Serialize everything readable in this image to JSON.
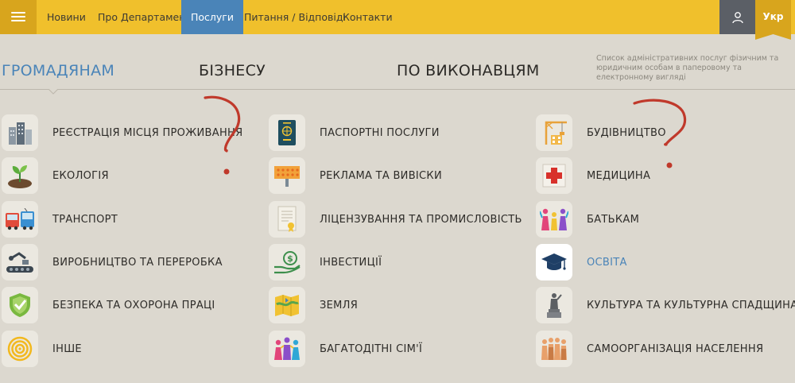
{
  "header": {
    "nav": [
      {
        "label": "Новини"
      },
      {
        "label": "Про Департамент"
      },
      {
        "label": "Послуги"
      },
      {
        "label": "Питання / Відповіді"
      },
      {
        "label": "Контакти"
      }
    ],
    "lang": "Укр"
  },
  "tabs": [
    {
      "label": "ГРОМАДЯНАМ"
    },
    {
      "label": "БІЗНЕСУ"
    },
    {
      "label": "ПО ВИКОНАВЦЯМ"
    }
  ],
  "tabs_description": "Список адміністративних послуг фізичним та юридичним особам в паперовому та електронному вигляді",
  "columns": [
    {
      "items": [
        {
          "label": "РЕЄСТРАЦІЯ МІСЦЯ ПРОЖИВАННЯ",
          "icon": "buildings-icon"
        },
        {
          "label": "ЕКОЛОГІЯ",
          "icon": "sprout-icon"
        },
        {
          "label": "ТРАНСПОРТ",
          "icon": "bus-icon"
        },
        {
          "label": "ВИРОБНИЦТВО ТА ПЕРЕРОБКА",
          "icon": "conveyor-icon"
        },
        {
          "label": "БЕЗПЕКА ТА ОХОРОНА ПРАЦІ",
          "icon": "shield-check-icon"
        },
        {
          "label": "ІНШЕ",
          "icon": "target-icon"
        }
      ]
    },
    {
      "items": [
        {
          "label": "ПАСПОРТНІ ПОСЛУГИ",
          "icon": "passport-icon"
        },
        {
          "label": "РЕКЛАМА ТА ВИВІСКИ",
          "icon": "billboard-icon"
        },
        {
          "label": "ЛІЦЕНЗУВАННЯ ТА ПРОМИСЛОВІСТЬ",
          "icon": "certificate-icon"
        },
        {
          "label": "ІНВЕСТИЦІЇ",
          "icon": "money-hand-icon"
        },
        {
          "label": "ЗЕМЛЯ",
          "icon": "map-icon"
        },
        {
          "label": "БАГАТОДІТНІ СІМ'Ї",
          "icon": "family-icon"
        }
      ]
    },
    {
      "items": [
        {
          "label": "БУДІВНИЦТВО",
          "icon": "crane-icon"
        },
        {
          "label": "МЕДИЦИНА",
          "icon": "medical-cross-icon"
        },
        {
          "label": "БАТЬКАМ",
          "icon": "parents-icon"
        },
        {
          "label": "ОСВІТА",
          "icon": "graduation-cap-icon"
        },
        {
          "label": "КУЛЬТУРА ТА КУЛЬТУРНА СПАДЩИНА",
          "icon": "monument-icon"
        },
        {
          "label": "САМООРГАНІЗАЦІЯ НАСЕЛЕННЯ",
          "icon": "crowd-icon"
        }
      ]
    }
  ],
  "colors": {
    "topbar": "#f0c02c",
    "topbar_dark": "#d8a51d",
    "active_blue": "#4a84b8",
    "background": "#dcd8cf",
    "annotation_red": "#c0392b"
  }
}
